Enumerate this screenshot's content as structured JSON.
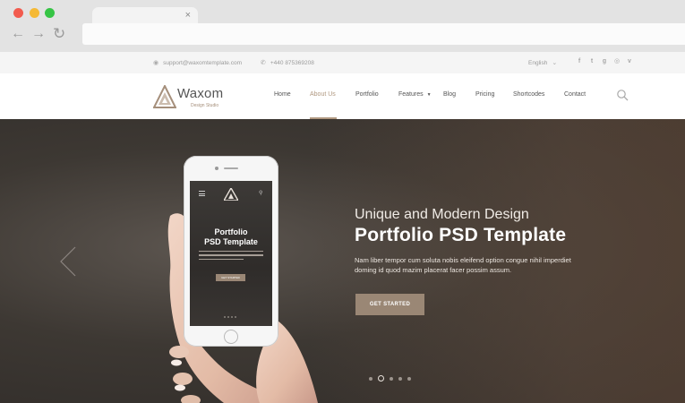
{
  "browser": {
    "tab_close": "×",
    "nav_back": "←",
    "nav_forward": "→",
    "nav_reload": "↻"
  },
  "topbar": {
    "email": "support@waxomtemplate.com",
    "phone": "+440 875369208",
    "language": "English",
    "socials": [
      "facebook-icon",
      "twitter-icon",
      "google-plus-icon",
      "instagram-icon",
      "vimeo-icon"
    ]
  },
  "header": {
    "logo_name": "Waxom",
    "logo_tagline": "Design Studio",
    "menu": [
      {
        "label": "Home"
      },
      {
        "label": "About Us",
        "active": true
      },
      {
        "label": "Portfolio"
      },
      {
        "label": "Features"
      },
      {
        "label": "Blog"
      },
      {
        "label": "Pricing"
      },
      {
        "label": "Shortcodes"
      },
      {
        "label": "Contact"
      }
    ]
  },
  "hero": {
    "subtitle": "Unique and Modern Design",
    "title": "Portfolio PSD Template",
    "description": "Nam liber tempor cum soluta nobis eleifend option congue nihil imperdiet doming id quod mazim placerat facer possim assum.",
    "cta_label": "GET STARTED",
    "slides": 5,
    "active_slide": 2,
    "phone_screen": {
      "title_line1": "Portfolio",
      "title_line2": "PSD Template",
      "button": "GET STARTED"
    }
  },
  "colors": {
    "accent": "#9a8775",
    "active_menu": "#b09880"
  }
}
